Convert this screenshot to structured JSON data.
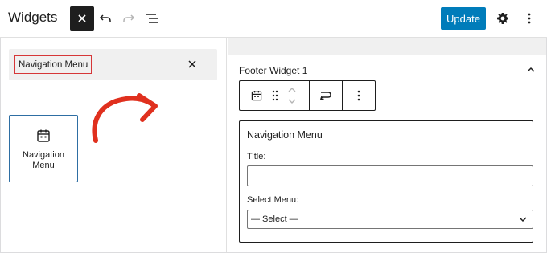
{
  "header": {
    "title": "Widgets",
    "update_label": "Update"
  },
  "inserter": {
    "search_value": "Navigation Menu",
    "result": {
      "label": "Navigation Menu",
      "icon": "calendar-icon"
    }
  },
  "widget_area": {
    "title": "Footer Widget 1",
    "block": {
      "title": "Navigation Menu",
      "title_label": "Title:",
      "title_value": "",
      "select_label": "Select Menu:",
      "select_value": "— Select —"
    }
  },
  "colors": {
    "accent": "#007cba",
    "highlight": "#d63638",
    "arrow": "#e0301e",
    "dark": "#1e1e1e"
  }
}
